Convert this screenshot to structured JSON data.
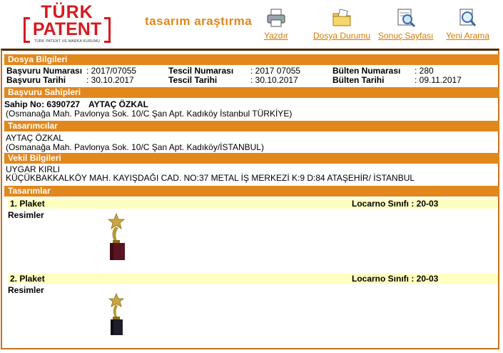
{
  "header": {
    "logo_top": "TÜRK",
    "logo_bottom": "PATENT",
    "logo_sub": "TÜRK PATENT VE MARKA KURUMU",
    "app_title": "tasarım araştırma",
    "nav": [
      {
        "label": "Yazdır",
        "icon": "printer-icon"
      },
      {
        "label": "Dosya Durumu",
        "icon": "folder-icon"
      },
      {
        "label": "Sonuç Sayfası",
        "icon": "results-page-icon"
      },
      {
        "label": "Yeni Arama",
        "icon": "new-search-icon"
      }
    ]
  },
  "file_info": {
    "title": "Dosya Bilgileri",
    "application_number_label": "Başvuru Numarası",
    "application_number": ": 2017/07055",
    "application_date_label": "Başvuru Tarihi",
    "application_date": ": 30.10.2017",
    "registration_number_label": "Tescil Numarası",
    "registration_number": ": 2017 07055",
    "registration_date_label": "Tescil Tarihi",
    "registration_date": ": 30.10.2017",
    "bulletin_number_label": "Bülten Numarası",
    "bulletin_number": ": 280",
    "bulletin_date_label": "Bülten Tarihi",
    "bulletin_date": ": 09.11.2017"
  },
  "applicants": {
    "title": "Başvuru Sahipleri",
    "owner_no": "Sahip No: 6390727",
    "owner_name": "AYTAÇ ÖZKAL",
    "owner_address": "(Osmanağa Mah. Pavlonya Sok. 10/C Şan Apt. Kadıköy İstanbul TÜRKİYE)"
  },
  "designers": {
    "title": "Tasarımcılar",
    "name": "AYTAÇ ÖZKAL",
    "address": "(Osmanağa Mah. Pavlonya Sok. 10/C Şan Apt. Kadıköy/İSTANBUL)"
  },
  "attorney": {
    "title": "Vekil Bilgileri",
    "name": "UYGAR KIRLI",
    "address": "KÜÇÜKBAKKALKÖY MAH. KAYIŞDAĞI CAD. NO:37 METAL İŞ MERKEZİ K:9 D:84 ATAŞEHİR/ İSTANBUL"
  },
  "designs": {
    "title": "Tasarımlar",
    "items": [
      {
        "name": "1. Plaket",
        "locarno": "Locarno Sınıfı : 20-03",
        "images_label": "Resimler",
        "image_icon": "trophy-icon"
      },
      {
        "name": "2. Plaket",
        "locarno": "Locarno Sınıfı : 20-03",
        "images_label": "Resimler",
        "image_icon": "trophy-icon"
      }
    ]
  },
  "colors": {
    "accent_orange": "#e2871b",
    "logo_red": "#d71920",
    "design_bar_yellow": "#ffffc0"
  }
}
